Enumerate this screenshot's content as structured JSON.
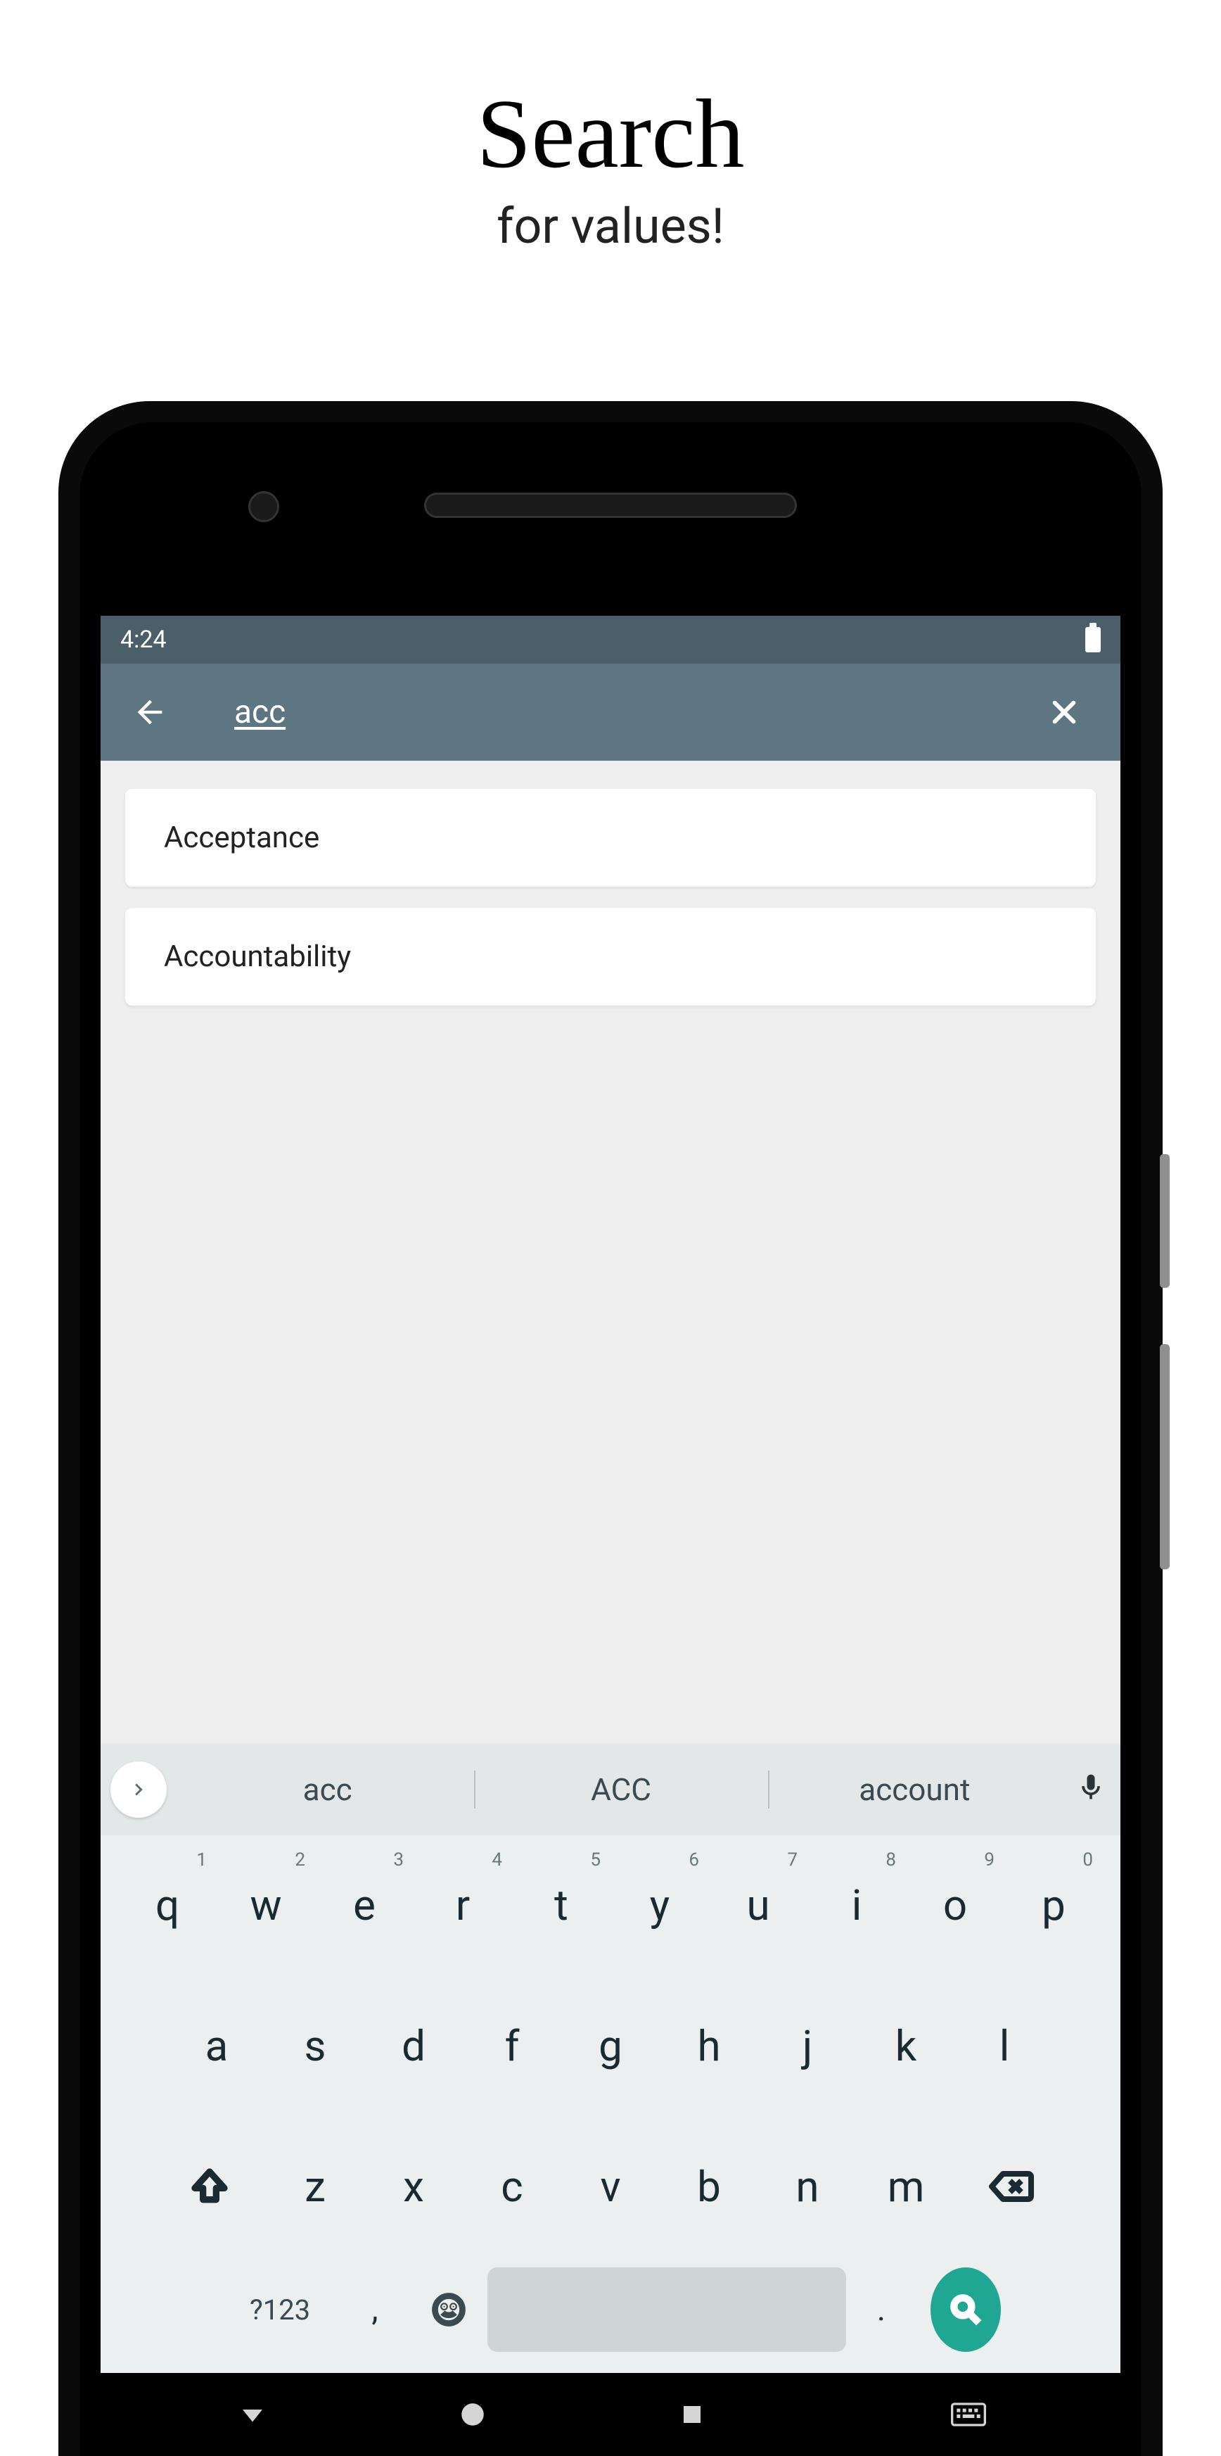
{
  "header": {
    "title": "Search",
    "subtitle": "for values!"
  },
  "status": {
    "time": "4:24"
  },
  "search": {
    "query": "acc"
  },
  "results": [
    {
      "label": "Acceptance"
    },
    {
      "label": "Accountability"
    }
  ],
  "keyboard": {
    "suggestions": [
      "acc",
      "ACC",
      "account"
    ],
    "row1": [
      {
        "main": "q",
        "corner": "1"
      },
      {
        "main": "w",
        "corner": "2"
      },
      {
        "main": "e",
        "corner": "3"
      },
      {
        "main": "r",
        "corner": "4"
      },
      {
        "main": "t",
        "corner": "5"
      },
      {
        "main": "y",
        "corner": "6"
      },
      {
        "main": "u",
        "corner": "7"
      },
      {
        "main": "i",
        "corner": "8"
      },
      {
        "main": "o",
        "corner": "9"
      },
      {
        "main": "p",
        "corner": "0"
      }
    ],
    "row2": [
      "a",
      "s",
      "d",
      "f",
      "g",
      "h",
      "j",
      "k",
      "l"
    ],
    "row3": [
      "z",
      "x",
      "c",
      "v",
      "b",
      "n",
      "m"
    ],
    "mode_label": "?123",
    "comma": ",",
    "period": "."
  }
}
